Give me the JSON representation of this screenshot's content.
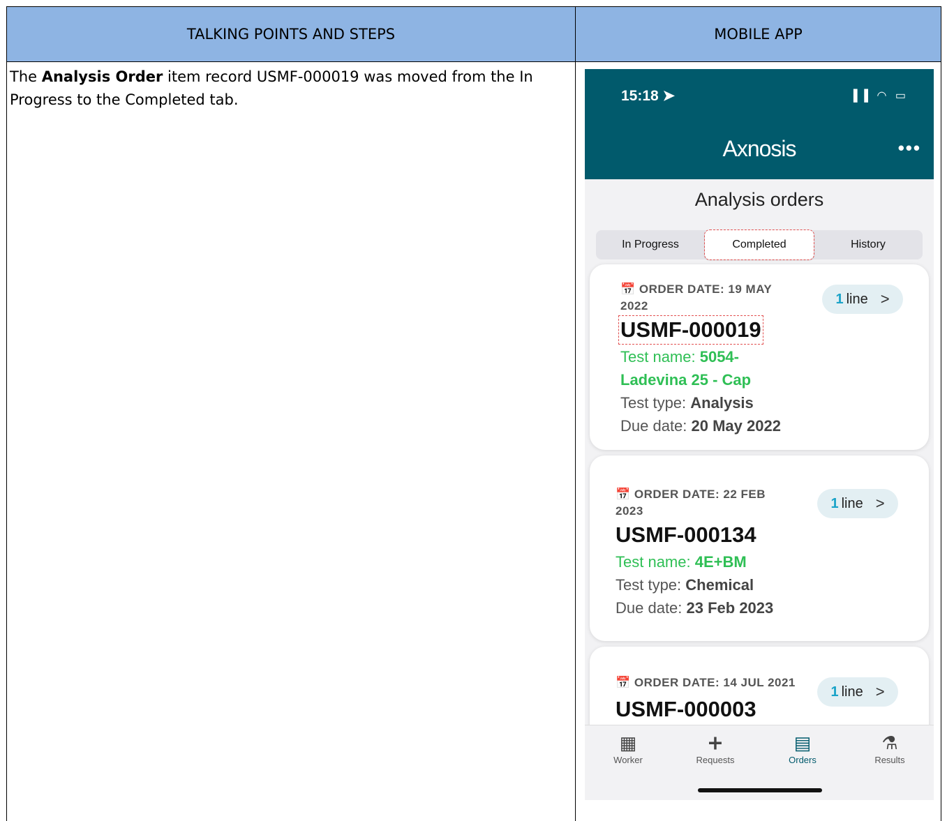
{
  "table": {
    "col_left_header": "TALKING POINTS AND STEPS",
    "col_right_header": "MOBILE APP",
    "talk_prefix": "The ",
    "talk_bold": "Analysis Order",
    "talk_suffix": " item record USMF-000019 was moved from the In Progress to the Completed tab."
  },
  "phone": {
    "time": "15:18 ➤",
    "status": "▐▐ ◠ ▭",
    "logo": "Axnosis",
    "more": "•••",
    "title": "Analysis orders",
    "tabs": [
      "In Progress",
      "Completed",
      "History"
    ],
    "selected_tab": "Completed",
    "orders": [
      {
        "date_line1": "📅 ORDER DATE: 19 MAY",
        "date_line2": "2022",
        "lines_count": "1",
        "lines_label": "line",
        "number": "USMF-000019",
        "test_name_label": "Test name: ",
        "test_name_line1": "5054-",
        "test_name_line2": "Ladevina 25 - Cap",
        "test_type_label": "Test type: ",
        "test_type": "Analysis",
        "due_label": "Due date: ",
        "due": "20 May 2022"
      },
      {
        "date_line1": "📅 ORDER DATE: 22 FEB",
        "date_line2": "2023",
        "lines_count": "1",
        "lines_label": "line",
        "number": "USMF-000134",
        "test_name_label": "Test name: ",
        "test_name_line1": "4E+BM",
        "test_type_label": "Test type: ",
        "test_type": "Chemical",
        "due_label": "Due date: ",
        "due": "23 Feb 2023"
      },
      {
        "date_line1": "📅 ORDER DATE: 14 JUL 2021",
        "lines_count": "1",
        "lines_label": "line",
        "number": "USMF-000003"
      }
    ],
    "nav": [
      {
        "label": "Worker",
        "icon": "qr-code-icon",
        "glyph": "▦"
      },
      {
        "label": "Requests",
        "icon": "add-person-icon",
        "glyph": "➕︎"
      },
      {
        "label": "Orders",
        "icon": "orders-icon",
        "glyph": "▤"
      },
      {
        "label": "Results",
        "icon": "flask-icon",
        "glyph": "⚗"
      }
    ],
    "colors": {
      "header": "#015a6c",
      "accent_green": "#2fbf55",
      "accent_blue": "#1aa3c8"
    }
  }
}
